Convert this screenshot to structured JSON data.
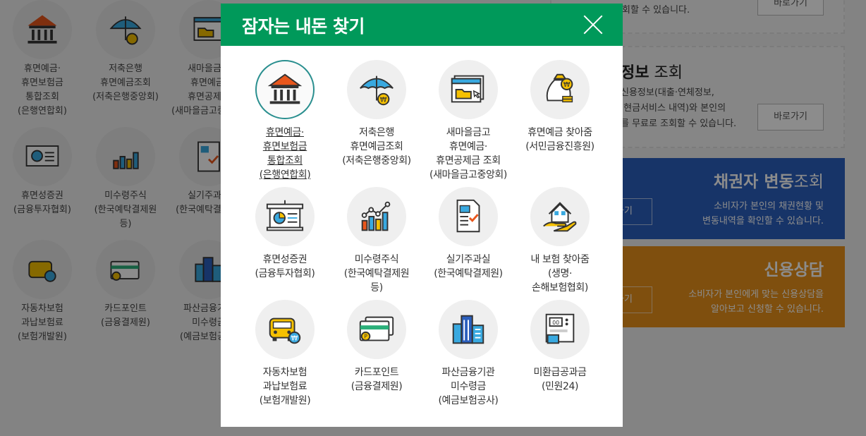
{
  "modal": {
    "title": "잠자는 내돈 찾기",
    "items": [
      {
        "label": "휴면예금·\n휴면보험금\n통합조회\n(은행연합회)",
        "icon": "bank-icon"
      },
      {
        "label": "저축은행\n휴면예금조회\n(저축은행중앙회)",
        "icon": "umbrella-won-icon"
      },
      {
        "label": "새마을금고\n휴면예금·\n휴면공제금 조회\n(새마을금고중앙회)",
        "icon": "browser-folder-icon"
      },
      {
        "label": "휴면예금 찾아줌\n(서민금융진흥원)",
        "icon": "money-bag-icon"
      },
      {
        "label": "휴면성증권\n(금융투자협회)",
        "icon": "presentation-board-icon"
      },
      {
        "label": "미수령주식\n(한국예탁결제원\n등)",
        "icon": "bar-chart-icon"
      },
      {
        "label": "실기주과실\n(한국예탁결제원)",
        "icon": "document-check-icon"
      },
      {
        "label": "내 보험 찾아줌\n(생명·\n손해보험협회)",
        "icon": "house-hand-icon"
      },
      {
        "label": "자동차보험\n과납보험료\n(보험개발원)",
        "icon": "car-won-icon"
      },
      {
        "label": "카드포인트\n(금융결제원)",
        "icon": "credit-card-icon"
      },
      {
        "label": "파산금융기관\n미수령금\n(예금보험공사)",
        "icon": "buildings-icon"
      },
      {
        "label": "미환급공과금\n(민원24)",
        "icon": "meter-icon"
      }
    ]
  },
  "background": {
    "grid": [
      "휴면예금·\n휴면보험금\n통합조회\n(은행연합회)",
      "저축은행\n휴면예금조회\n(저축은행중앙회)",
      "새마을금고\n휴면예금·\n휴면공제금\n(새마을금고중앙회)",
      "휴면성증권\n(금융투자협회)",
      "미수령주식\n(한국예탁결제원\n등)",
      "실기주과실\n(한국예탁결제원)",
      "자동차보험\n과납보험료\n(보험개발원)",
      "카드포인트\n(금융결제원)",
      "파산금융기관\n미수령금\n(예금보험공사)"
    ],
    "top_desc": "등을 조회할 수 있습니다.",
    "shortcut_label": "바로가기",
    "credit_info": {
      "title_bold": "정보",
      "title_rest": " 조회",
      "desc": "신용정보(대출·연체정보,\n·현금서비스 내역)와 본인의\n를 무료로 조회할 수 있습니다."
    },
    "creditor": {
      "title_bold": "채권자 변동",
      "title_rest": "조회",
      "desc": "소비자가 본인의 채권현황 및\n변동내역을 확인할 수 있습니다.",
      "button": "가기"
    },
    "counsel": {
      "title": "신용상담",
      "desc": "소비자가 본인에게 맞는 신용상담을\n알아보고 신청할 수 있습니다.",
      "button": "가기"
    }
  },
  "colors": {
    "header_green": "#00995a",
    "creditor_blue": "#2b5fbd",
    "counsel_orange": "#e8901a"
  }
}
